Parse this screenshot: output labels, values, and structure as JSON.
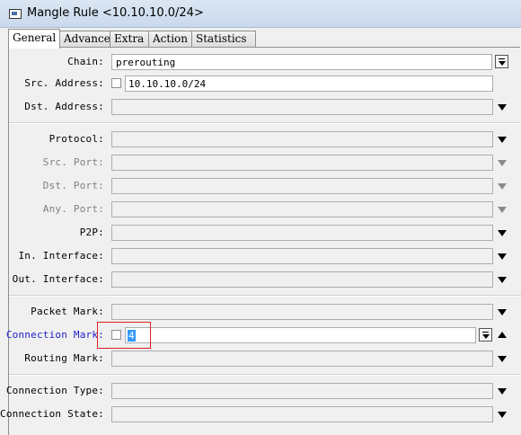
{
  "window": {
    "title": "Mangle Rule <10.10.10.0/24>"
  },
  "tabs": [
    "General",
    "Advanced",
    "Extra",
    "Action",
    "Statistics"
  ],
  "fields": {
    "chain": {
      "label": "Chain:",
      "value": "prerouting"
    },
    "src_address": {
      "label": "Src. Address:",
      "value": "10.10.10.0/24"
    },
    "dst_address": {
      "label": "Dst. Address:",
      "value": ""
    },
    "protocol": {
      "label": "Protocol:",
      "value": ""
    },
    "src_port": {
      "label": "Src. Port:",
      "value": ""
    },
    "dst_port": {
      "label": "Dst. Port:",
      "value": ""
    },
    "any_port": {
      "label": "Any. Port:",
      "value": ""
    },
    "p2p": {
      "label": "P2P:",
      "value": ""
    },
    "in_interface": {
      "label": "In. Interface:",
      "value": ""
    },
    "out_interface": {
      "label": "Out. Interface:",
      "value": ""
    },
    "packet_mark": {
      "label": "Packet Mark:",
      "value": ""
    },
    "connection_mark": {
      "label": "Connection Mark:",
      "value": "4"
    },
    "routing_mark": {
      "label": "Routing Mark:",
      "value": ""
    },
    "connection_type": {
      "label": "Connection Type:",
      "value": ""
    },
    "connection_state": {
      "label": "Connection State:",
      "value": ""
    }
  },
  "colors": {
    "active_label": "#1e1ec8",
    "disabled_label": "#808080",
    "highlight_box": "#e02020",
    "selection": "#3399ff"
  }
}
